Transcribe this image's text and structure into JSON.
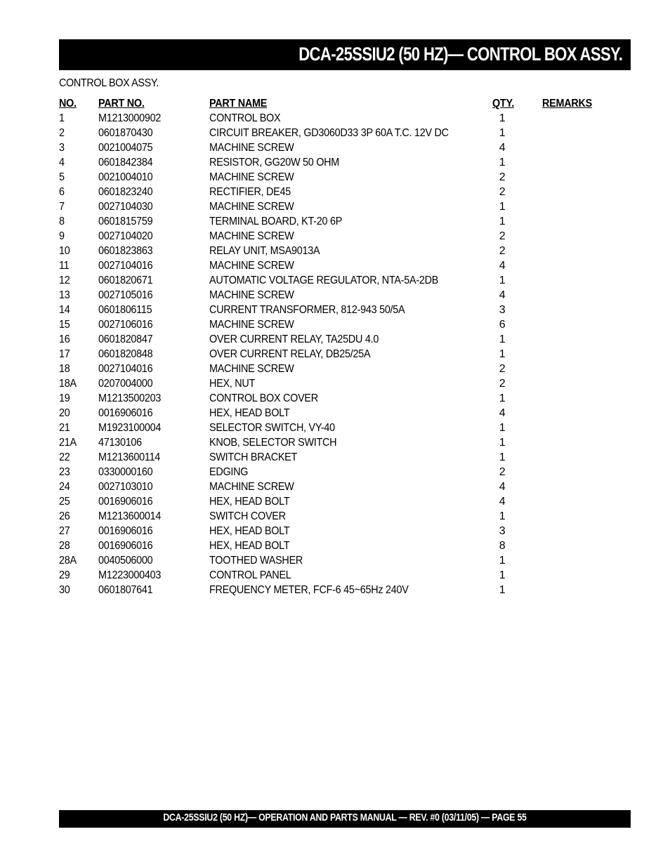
{
  "header": {
    "title": "DCA-25SSIU2 (50 HZ)— CONTROL BOX  ASSY."
  },
  "section": {
    "label": "CONTROL BOX ASSY."
  },
  "table": {
    "columns": {
      "no": "NO.",
      "part_no": "PART NO.",
      "part_name": "PART NAME",
      "qty": "QTY.",
      "remarks": "REMARKS"
    },
    "rows": [
      {
        "no": "1",
        "part_no": "M1213000902",
        "part_name": "CONTROL BOX",
        "qty": "1",
        "remarks": ""
      },
      {
        "no": "2",
        "part_no": "0601870430",
        "part_name": "CIRCUIT BREAKER, GD3060D33 3P 60A T.C. 12V DC",
        "qty": "1",
        "remarks": ""
      },
      {
        "no": "3",
        "part_no": "0021004075",
        "part_name": "MACHINE SCREW",
        "qty": "4",
        "remarks": ""
      },
      {
        "no": "4",
        "part_no": "0601842384",
        "part_name": "RESISTOR, GG20W 50 OHM",
        "qty": "1",
        "remarks": ""
      },
      {
        "no": "5",
        "part_no": "0021004010",
        "part_name": "MACHINE SCREW",
        "qty": "2",
        "remarks": ""
      },
      {
        "no": "6",
        "part_no": "0601823240",
        "part_name": "RECTIFIER, DE45",
        "qty": "2",
        "remarks": ""
      },
      {
        "no": "7",
        "part_no": "0027104030",
        "part_name": "MACHINE SCREW",
        "qty": "1",
        "remarks": ""
      },
      {
        "no": "8",
        "part_no": "0601815759",
        "part_name": "TERMINAL BOARD, KT-20 6P",
        "qty": "1",
        "remarks": ""
      },
      {
        "no": "9",
        "part_no": "0027104020",
        "part_name": "MACHINE SCREW",
        "qty": "2",
        "remarks": ""
      },
      {
        "no": "10",
        "part_no": "0601823863",
        "part_name": "RELAY UNIT, MSA9013A",
        "qty": "2",
        "remarks": ""
      },
      {
        "no": "11",
        "part_no": "0027104016",
        "part_name": "MACHINE SCREW",
        "qty": "4",
        "remarks": ""
      },
      {
        "no": "12",
        "part_no": "0601820671",
        "part_name": "AUTOMATIC VOLTAGE REGULATOR, NTA-5A-2DB",
        "qty": "1",
        "remarks": ""
      },
      {
        "no": "13",
        "part_no": "0027105016",
        "part_name": "MACHINE SCREW",
        "qty": "4",
        "remarks": ""
      },
      {
        "no": "14",
        "part_no": "0601806115",
        "part_name": "CURRENT TRANSFORMER, 812-943 50/5A",
        "qty": "3",
        "remarks": ""
      },
      {
        "no": "15",
        "part_no": "0027106016",
        "part_name": "MACHINE SCREW",
        "qty": "6",
        "remarks": ""
      },
      {
        "no": "16",
        "part_no": "0601820847",
        "part_name": "OVER CURRENT RELAY, TA25DU 4.0",
        "qty": "1",
        "remarks": ""
      },
      {
        "no": "17",
        "part_no": "0601820848",
        "part_name": "OVER CURRENT RELAY, DB25/25A",
        "qty": "1",
        "remarks": ""
      },
      {
        "no": "18",
        "part_no": "0027104016",
        "part_name": "MACHINE SCREW",
        "qty": "2",
        "remarks": ""
      },
      {
        "no": "18A",
        "part_no": "0207004000",
        "part_name": "HEX, NUT",
        "qty": "2",
        "remarks": ""
      },
      {
        "no": "19",
        "part_no": "M1213500203",
        "part_name": "CONTROL BOX COVER",
        "qty": "1",
        "remarks": ""
      },
      {
        "no": "20",
        "part_no": "0016906016",
        "part_name": "HEX, HEAD BOLT",
        "qty": "4",
        "remarks": ""
      },
      {
        "no": "21",
        "part_no": "M1923100004",
        "part_name": "SELECTOR SWITCH, VY-40",
        "qty": "1",
        "remarks": ""
      },
      {
        "no": "21A",
        "part_no": "47130106",
        "part_name": "KNOB, SELECTOR SWITCH",
        "qty": "1",
        "remarks": ""
      },
      {
        "no": "22",
        "part_no": "M1213600114",
        "part_name": "SWITCH BRACKET",
        "qty": "1",
        "remarks": ""
      },
      {
        "no": "23",
        "part_no": "0330000160",
        "part_name": "EDGING",
        "qty": "2",
        "remarks": ""
      },
      {
        "no": "24",
        "part_no": "0027103010",
        "part_name": "MACHINE SCREW",
        "qty": "4",
        "remarks": ""
      },
      {
        "no": "25",
        "part_no": "0016906016",
        "part_name": "HEX, HEAD BOLT",
        "qty": "4",
        "remarks": ""
      },
      {
        "no": "26",
        "part_no": "M1213600014",
        "part_name": "SWITCH COVER",
        "qty": "1",
        "remarks": ""
      },
      {
        "no": "27",
        "part_no": "0016906016",
        "part_name": "HEX, HEAD BOLT",
        "qty": "3",
        "remarks": ""
      },
      {
        "no": "28",
        "part_no": "0016906016",
        "part_name": "HEX, HEAD BOLT",
        "qty": "8",
        "remarks": ""
      },
      {
        "no": "28A",
        "part_no": "0040506000",
        "part_name": "TOOTHED WASHER",
        "qty": "1",
        "remarks": ""
      },
      {
        "no": "29",
        "part_no": "M1223000403",
        "part_name": "CONTROL PANEL",
        "qty": "1",
        "remarks": ""
      },
      {
        "no": "30",
        "part_no": "0601807641",
        "part_name": "FREQUENCY METER, FCF-6 45~65Hz 240V",
        "qty": "1",
        "remarks": ""
      }
    ]
  },
  "footer": {
    "text": "DCA-25SSIU2 (50 HZ)— OPERATION AND PARTS MANUAL — REV. #0  (03/11/05) — PAGE 55"
  }
}
